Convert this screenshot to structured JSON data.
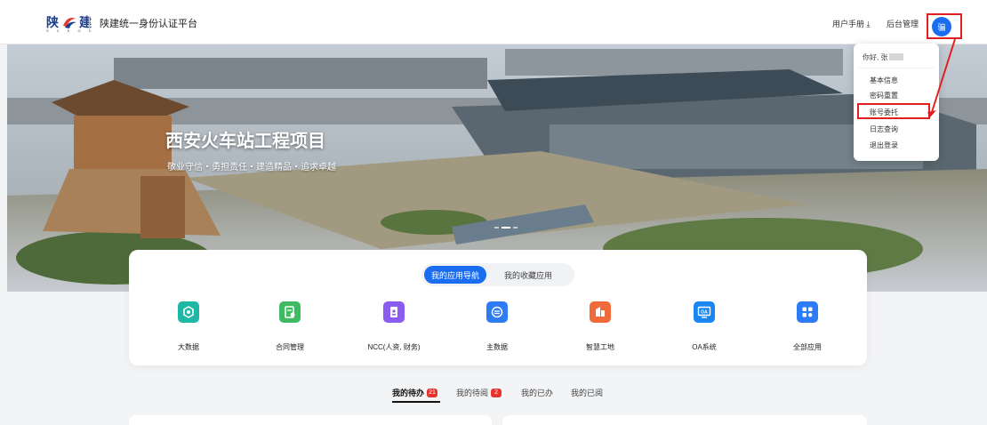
{
  "header": {
    "logo_text_left": "陕",
    "logo_text_right": "建",
    "logo_sub": "S C E G C",
    "platform_title": "陕建统一身份认证平台",
    "user_manual": "用户手册 ⤓",
    "admin": "后台管理",
    "avatar_text": "骗"
  },
  "banner": {
    "title": "西安火车站工程项目",
    "subtitle": "敬业守信・勇担责任・建造精品・追求卓越"
  },
  "user_menu": {
    "greeting": "你好, 张",
    "items": [
      "基本信息",
      "密码重置",
      "账号委托",
      "日志查询",
      "退出登录"
    ]
  },
  "app_nav": {
    "tab_active": "我的应用导航",
    "tab_inactive": "我的收藏应用",
    "apps": [
      {
        "label": "大数据",
        "icon": "big-data-icon",
        "color": "#1fb7a6"
      },
      {
        "label": "合同管理",
        "icon": "contract-icon",
        "color": "#3fba63"
      },
      {
        "label": "NCC(人资, 财务)",
        "icon": "ncc-icon",
        "color": "#8a5cf0"
      },
      {
        "label": "主数据",
        "icon": "master-data-icon",
        "color": "#2d7cf6"
      },
      {
        "label": "智慧工地",
        "icon": "smart-site-icon",
        "color": "#f06a3a"
      },
      {
        "label": "OA系统",
        "icon": "oa-icon",
        "color": "#1a86f0"
      },
      {
        "label": "全部应用",
        "icon": "all-apps-icon",
        "color": "#2d7cf6"
      }
    ]
  },
  "tasks": {
    "tabs": [
      {
        "label": "我的待办",
        "badge": "21"
      },
      {
        "label": "我的待阅",
        "badge": "2"
      },
      {
        "label": "我的已办",
        "badge": ""
      },
      {
        "label": "我的已阅",
        "badge": ""
      }
    ]
  }
}
